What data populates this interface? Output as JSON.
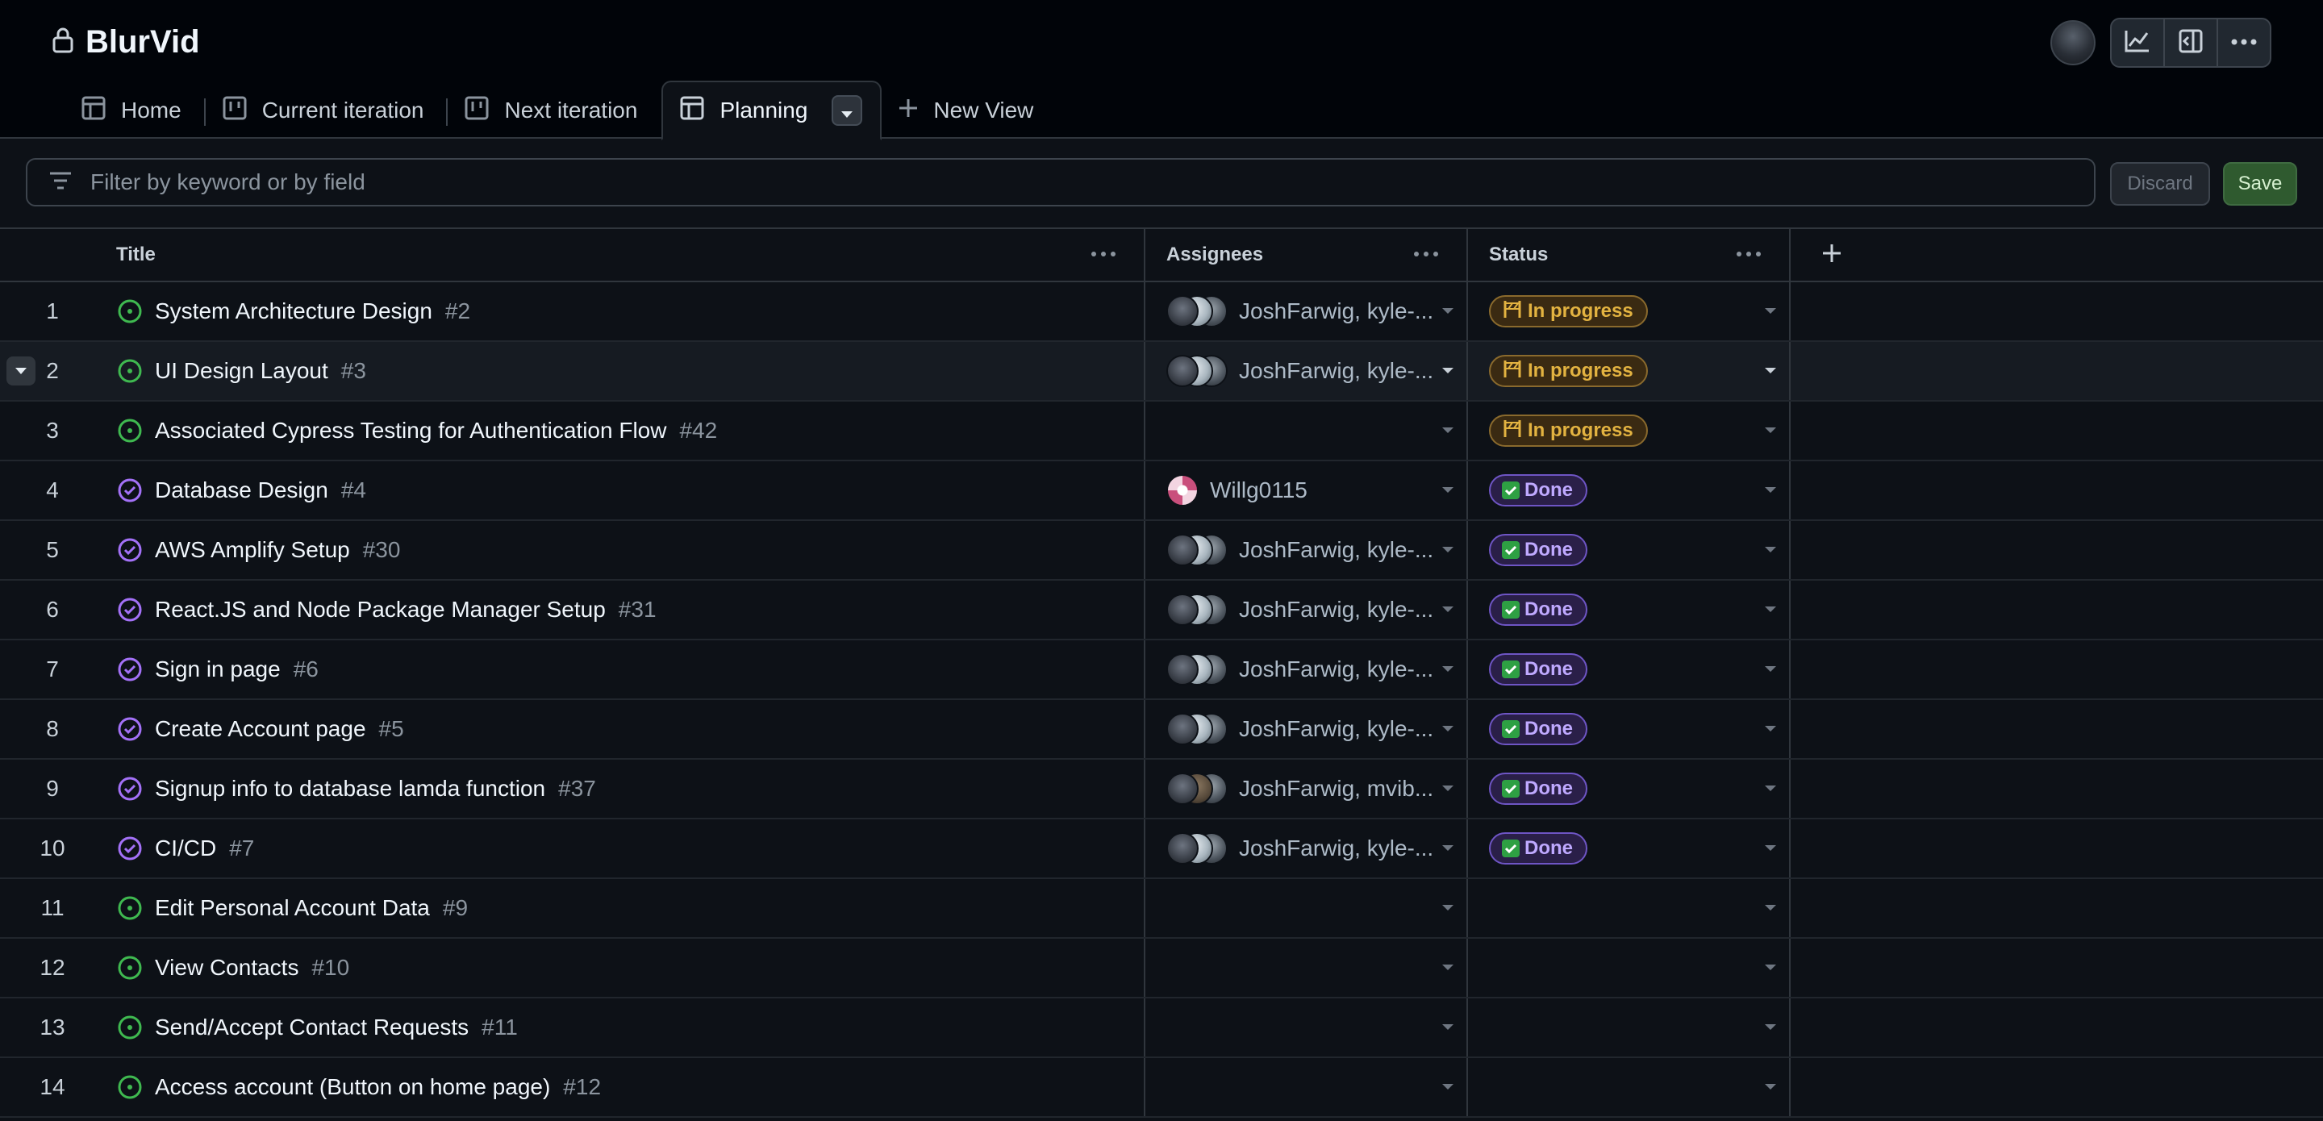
{
  "project": {
    "title": "BlurVid"
  },
  "top_actions": {
    "avatar": "user-avatar",
    "icons": [
      "insights-icon",
      "side-panel-icon",
      "kebab-icon"
    ]
  },
  "tabs": [
    {
      "label": "Home",
      "icon": "table-icon"
    },
    {
      "label": "Current iteration",
      "icon": "board-icon"
    },
    {
      "label": "Next iteration",
      "icon": "board-icon"
    },
    {
      "label": "Planning",
      "icon": "table-icon",
      "active": true
    },
    {
      "label": "New View",
      "icon": "plus-icon"
    }
  ],
  "filter": {
    "placeholder": "Filter by keyword or by field",
    "value": ""
  },
  "buttons": {
    "discard": "Discard",
    "save": "Save"
  },
  "columns": {
    "title": "Title",
    "assignees": "Assignees",
    "status": "Status"
  },
  "colors": {
    "open_icon": "#3fb950",
    "closed_icon": "#a371f7",
    "in_progress": "#e3b341",
    "done": "#bfa9ff",
    "save_bg": "#2f5a2f"
  },
  "rows": [
    {
      "num": "1",
      "title": "System Architecture Design",
      "issue": "#2",
      "state": "open",
      "assignees": "JoshFarwig, kyle-...",
      "avatars": 3,
      "status": "In progress"
    },
    {
      "num": "2",
      "title": "UI Design Layout",
      "issue": "#3",
      "state": "open",
      "assignees": "JoshFarwig, kyle-...",
      "avatars": 3,
      "status": "In progress"
    },
    {
      "num": "3",
      "title": "Associated Cypress Testing for Authentication Flow",
      "issue": "#42",
      "state": "open",
      "assignees": "",
      "avatars": 0,
      "status": "In progress"
    },
    {
      "num": "4",
      "title": "Database Design",
      "issue": "#4",
      "state": "closed",
      "assignees": "Willg0115",
      "avatars": 1,
      "status": "Done"
    },
    {
      "num": "5",
      "title": "AWS Amplify Setup",
      "issue": "#30",
      "state": "closed",
      "assignees": "JoshFarwig, kyle-...",
      "avatars": 3,
      "status": "Done"
    },
    {
      "num": "6",
      "title": "React.JS and Node Package Manager Setup",
      "issue": "#31",
      "state": "closed",
      "assignees": "JoshFarwig, kyle-...",
      "avatars": 3,
      "status": "Done"
    },
    {
      "num": "7",
      "title": "Sign in page",
      "issue": "#6",
      "state": "closed",
      "assignees": "JoshFarwig, kyle-...",
      "avatars": 3,
      "status": "Done"
    },
    {
      "num": "8",
      "title": "Create Account page",
      "issue": "#5",
      "state": "closed",
      "assignees": "JoshFarwig, kyle-...",
      "avatars": 3,
      "status": "Done"
    },
    {
      "num": "9",
      "title": "Signup info to database lamda function",
      "issue": "#37",
      "state": "closed",
      "assignees": "JoshFarwig, mvib...",
      "avatars": 2,
      "status": "Done"
    },
    {
      "num": "10",
      "title": "CI/CD",
      "issue": "#7",
      "state": "closed",
      "assignees": "JoshFarwig, kyle-...",
      "avatars": 3,
      "status": "Done"
    },
    {
      "num": "11",
      "title": "Edit Personal Account Data",
      "issue": "#9",
      "state": "open",
      "assignees": "",
      "avatars": 0,
      "status": ""
    },
    {
      "num": "12",
      "title": "View Contacts",
      "issue": "#10",
      "state": "open",
      "assignees": "",
      "avatars": 0,
      "status": ""
    },
    {
      "num": "13",
      "title": "Send/Accept Contact Requests",
      "issue": "#11",
      "state": "open",
      "assignees": "",
      "avatars": 0,
      "status": ""
    },
    {
      "num": "14",
      "title": "Access account (Button on home page)",
      "issue": "#12",
      "state": "open",
      "assignees": "",
      "avatars": 0,
      "status": ""
    }
  ]
}
